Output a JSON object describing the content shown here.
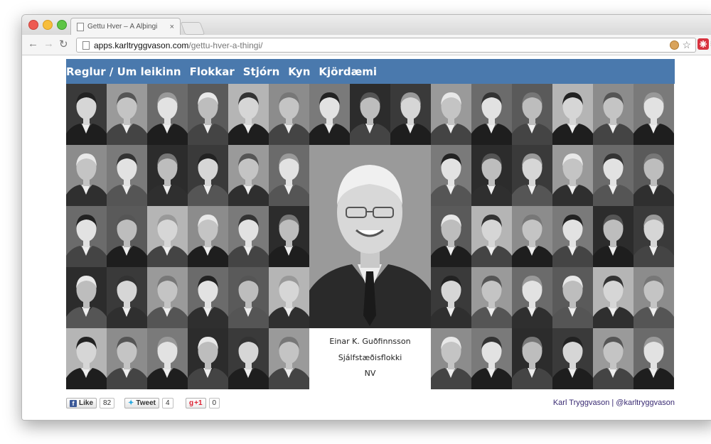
{
  "browser": {
    "tab_title": "Gettu Hver – Á Alþingi",
    "tab_close": "×",
    "url_host": "apps.karltryggvason.com",
    "url_path": "/gettu-hver-a-thingi/",
    "back_glyph": "←",
    "forward_glyph": "→",
    "reload_glyph": "↻",
    "star_glyph": "☆",
    "menu_glyph": "≡"
  },
  "nav": {
    "items": [
      "Reglur / Um leikinn",
      "Flokkar",
      "Stjórn",
      "Kyn",
      "Kjördæmi"
    ]
  },
  "featured": {
    "name": "Einar K. Guðfinnsson",
    "party": "Sjálfstæðisflokki",
    "district": "NV"
  },
  "footer": {
    "like_label": "Like",
    "like_count": "82",
    "tweet_label": "Tweet",
    "tweet_count": "4",
    "plus_label": "+1",
    "plus_count": "0",
    "credit": "Karl Tryggvason | @karltryggvason"
  },
  "colors": {
    "nav_bg": "#4a79ad",
    "credit": "#3a2b73"
  },
  "icons": {
    "portrait": "person-portrait-icon",
    "facebook": "facebook-icon",
    "twitter": "twitter-icon",
    "gplus": "google-plus-icon"
  }
}
